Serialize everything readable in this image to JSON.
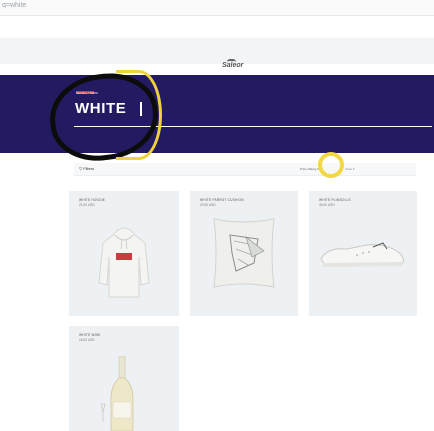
{
  "browser": {
    "url": "q=white"
  },
  "header": {
    "logo": "Saleor"
  },
  "search": {
    "label": "SEARCH TERM",
    "query": "WHITE"
  },
  "filters": {
    "left": "▽ Filters",
    "right": "Price Rating ▾",
    "right2": "Clear ▾"
  },
  "products": [
    {
      "name": "White Hoodie",
      "price": "21.00 USD"
    },
    {
      "name": "White Parrot Cushion",
      "price": "20.00 USD"
    },
    {
      "name": "White Plimsolls",
      "price": "40.00 USD"
    },
    {
      "name": "White Wine",
      "price": "16.00 USD"
    }
  ],
  "colors": {
    "banner": "#231b62",
    "annotation_yellow": "#f0d23c",
    "annotation_black": "#0c0c0c"
  }
}
